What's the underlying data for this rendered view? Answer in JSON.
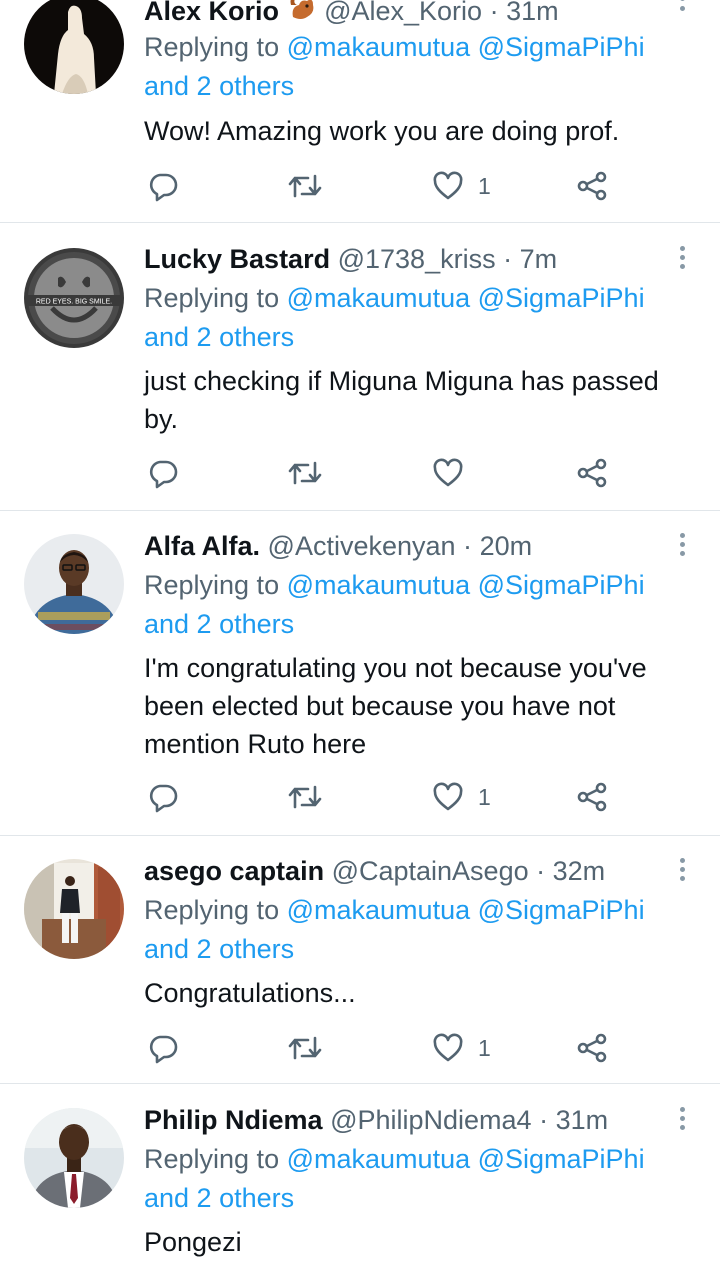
{
  "tweets": [
    {
      "name": "Alex Korio",
      "handle": "@Alex_Korio",
      "separator": "·",
      "time": "31m",
      "reply_prefix": "Replying to",
      "reply_users": "@makaumutua @SigmaPiPhi",
      "reply_others": "and 2 others",
      "text": "Wow! Amazing work you are doing prof.",
      "likes": "1",
      "avatar_icon": "dark-silhouette-avatar",
      "name_emoji": "squirrel-emoji"
    },
    {
      "name": "Lucky Bastard",
      "handle": "@1738_kriss",
      "separator": "·",
      "time": "7m",
      "reply_prefix": "Replying to",
      "reply_users": "@makaumutua @SigmaPiPhi",
      "reply_others": "and 2 others",
      "text_lines": [
        "just checking if Miguna Miguna has passed",
        "by."
      ],
      "likes": "",
      "avatar_icon": "smiley-face-avatar",
      "avatar_text": "RED EYES. BIG SMILE."
    },
    {
      "name": "Alfa Alfa.",
      "handle": "@Activekenyan",
      "separator": "·",
      "time": "20m",
      "reply_prefix": "Replying to",
      "reply_users": "@makaumutua @SigmaPiPhi",
      "reply_others": "and 2 others",
      "text_lines": [
        "I'm congratulating you not because you've",
        "been elected but because you have not",
        "mention Ruto here"
      ],
      "likes": "1",
      "avatar_icon": "person-photo-avatar"
    },
    {
      "name": "asego captain",
      "handle": "@CaptainAsego",
      "separator": "·",
      "time": "32m",
      "reply_prefix": "Replying to",
      "reply_users": "@makaumutua @SigmaPiPhi",
      "reply_others": "and 2 others",
      "text": "Congratulations...",
      "likes": "1",
      "avatar_icon": "standing-person-avatar"
    },
    {
      "name": "Philip Ndiema",
      "handle": "@PhilipNdiema4",
      "separator": "·",
      "time": "31m",
      "reply_prefix": "Replying to",
      "reply_users": "@makaumutua @SigmaPiPhi",
      "reply_others": "and 2 others",
      "text": "Pongezi",
      "avatar_icon": "suit-person-avatar"
    }
  ],
  "colors": {
    "link": "#1d9bf0",
    "secondary_text": "#536471",
    "primary_text": "#0f1419",
    "icon": "#536471",
    "divider": "#e1e6ea"
  },
  "icons": {
    "reply": "reply-icon",
    "retweet": "retweet-icon",
    "like": "heart-icon",
    "share": "share-icon",
    "more": "more-vertical-icon"
  }
}
